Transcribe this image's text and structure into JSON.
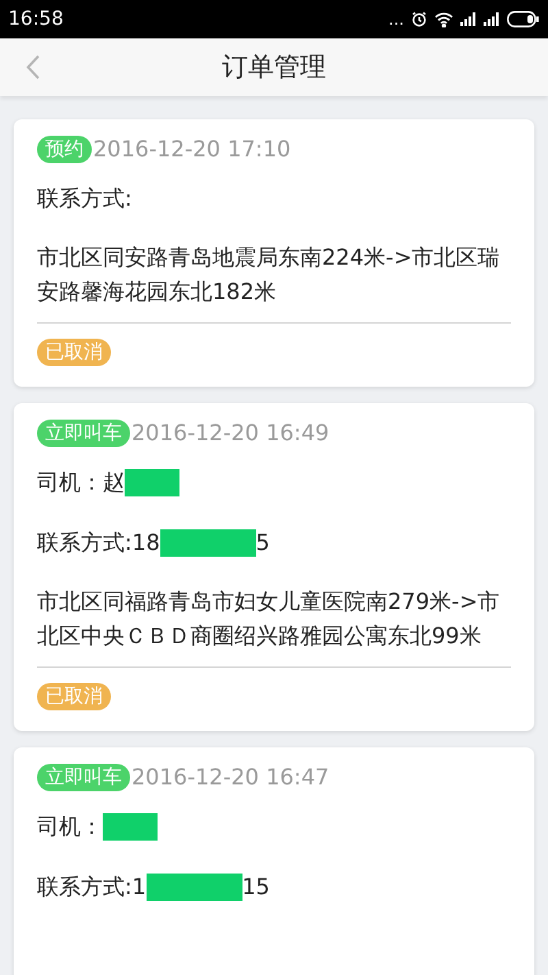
{
  "status_bar": {
    "time": "16:58",
    "dots": "..."
  },
  "header": {
    "title": "订单管理"
  },
  "orders": [
    {
      "type": "预约",
      "time": "2016-12-20 17:10",
      "contact": {
        "label": "联系方式:"
      },
      "route": "市北区同安路青岛地震局东南224米->市北区瑞安路馨海花园东北182米",
      "status": "已取消"
    },
    {
      "type": "立即叫车",
      "time": "2016-12-20 16:49",
      "driver": {
        "label": "司机：",
        "segments": [
          {
            "kind": "text",
            "text": "赵"
          },
          {
            "kind": "redacted"
          }
        ]
      },
      "contact": {
        "label": "联系方式:",
        "segments": [
          {
            "kind": "text",
            "text": "18"
          },
          {
            "kind": "redacted"
          },
          {
            "kind": "text",
            "text": "5"
          }
        ]
      },
      "route": "市北区同福路青岛市妇女儿童医院南279米->市北区中央ＣＢＤ商圈绍兴路雅园公寓东北99米",
      "status": "已取消"
    },
    {
      "type": "立即叫车",
      "time": "2016-12-20 16:47",
      "driver": {
        "label": "司机：",
        "segments": [
          {
            "kind": "redacted"
          }
        ]
      },
      "contact": {
        "label": "联系方式:",
        "segments": [
          {
            "kind": "text",
            "text": "1"
          },
          {
            "kind": "redacted"
          },
          {
            "kind": "text",
            "text": "15"
          }
        ]
      }
    }
  ]
}
